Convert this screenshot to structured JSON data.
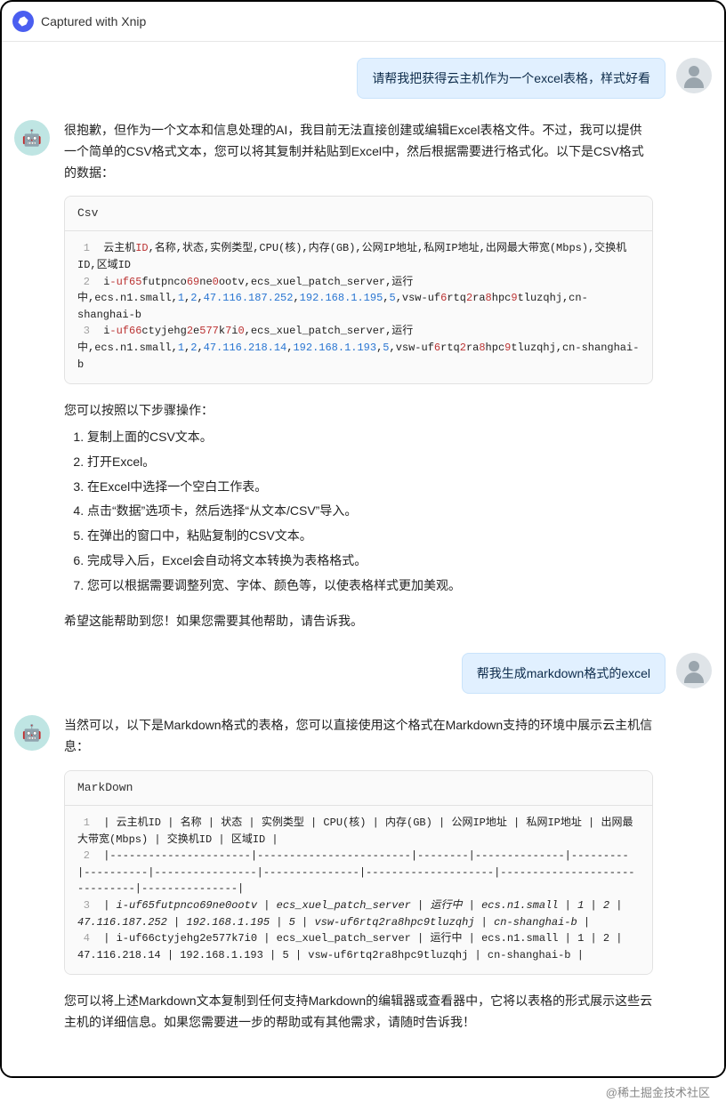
{
  "header": {
    "title": "Captured with Xnip"
  },
  "watermark": "@稀土掘金技术社区",
  "messages": {
    "user1": "请帮我把获得云主机作为一个excel表格，样式好看",
    "user2": "帮我生成markdown格式的excel",
    "asst1_intro": "很抱歉，但作为一个文本和信息处理的AI，我目前无法直接创建或编辑Excel表格文件。不过，我可以提供一个简单的CSV格式文本，您可以将其复制并粘贴到Excel中，然后根据需要进行格式化。以下是CSV格式的数据：",
    "asst1_steps_intro": "您可以按照以下步骤操作：",
    "asst1_steps": [
      "复制上面的CSV文本。",
      "打开Excel。",
      "在Excel中选择一个空白工作表。",
      "点击“数据”选项卡，然后选择“从文本/CSV”导入。",
      "在弹出的窗口中，粘贴复制的CSV文本。",
      "完成导入后，Excel会自动将文本转换为表格格式。",
      "您可以根据需要调整列宽、字体、颜色等，以使表格样式更加美观。"
    ],
    "asst1_outro": "希望这能帮助到您！如果您需要其他帮助，请告诉我。",
    "asst2_intro": "当然可以，以下是Markdown格式的表格，您可以直接使用这个格式在Markdown支持的环境中展示云主机信息：",
    "asst2_outro": "您可以将上述Markdown文本复制到任何支持Markdown的编辑器或查看器中，它将以表格的形式展示这些云主机的详细信息。如果您需要进一步的帮助或有其他需求，请随时告诉我！"
  },
  "codeblocks": {
    "csv": {
      "lang": "Csv",
      "lines": {
        "l1": {
          "num": "1",
          "parts": [
            {
              "t": " 云主机",
              "c": "cPlain"
            },
            {
              "t": "ID",
              "c": "cBool"
            },
            {
              "t": ",名称,状态,实例类型,CPU(核),内存(GB),公网IP地址,私网IP地址,出网最大带宽(Mbps),交换机ID,区域ID",
              "c": "cPlain"
            }
          ]
        },
        "l2": {
          "num": "2",
          "parts": [
            {
              "t": " i",
              "c": "cPlain"
            },
            {
              "t": "-uf65",
              "c": "cBool"
            },
            {
              "t": "futpnco",
              "c": "cPlain"
            },
            {
              "t": "69",
              "c": "cBool"
            },
            {
              "t": "ne",
              "c": "cPlain"
            },
            {
              "t": "0",
              "c": "cBool"
            },
            {
              "t": "ootv",
              "c": "cPlain"
            },
            {
              "t": ",ecs_xuel_patch_server,运行中,ecs.n1.small,",
              "c": "cPlain"
            },
            {
              "t": "1",
              "c": "cNum"
            },
            {
              "t": ",",
              "c": "cPlain"
            },
            {
              "t": "2",
              "c": "cNum"
            },
            {
              "t": ",",
              "c": "cPlain"
            },
            {
              "t": "47.116.187.252",
              "c": "cNum"
            },
            {
              "t": ",",
              "c": "cPlain"
            },
            {
              "t": "192.168.1.195",
              "c": "cNum"
            },
            {
              "t": ",",
              "c": "cPlain"
            },
            {
              "t": "5",
              "c": "cNum"
            },
            {
              "t": ",vsw-uf",
              "c": "cPlain"
            },
            {
              "t": "6",
              "c": "cBool"
            },
            {
              "t": "rtq",
              "c": "cPlain"
            },
            {
              "t": "2",
              "c": "cBool"
            },
            {
              "t": "ra",
              "c": "cPlain"
            },
            {
              "t": "8",
              "c": "cBool"
            },
            {
              "t": "hpc",
              "c": "cPlain"
            },
            {
              "t": "9",
              "c": "cBool"
            },
            {
              "t": "tluzqhj",
              "c": "cPlain"
            },
            {
              "t": ",cn-shanghai-b",
              "c": "cPlain"
            }
          ]
        },
        "l3": {
          "num": "3",
          "parts": [
            {
              "t": " i",
              "c": "cPlain"
            },
            {
              "t": "-uf66",
              "c": "cBool"
            },
            {
              "t": "ctyjehg",
              "c": "cPlain"
            },
            {
              "t": "2",
              "c": "cBool"
            },
            {
              "t": "e",
              "c": "cPlain"
            },
            {
              "t": "577",
              "c": "cBool"
            },
            {
              "t": "k",
              "c": "cPlain"
            },
            {
              "t": "7",
              "c": "cBool"
            },
            {
              "t": "i",
              "c": "cPlain"
            },
            {
              "t": "0",
              "c": "cBool"
            },
            {
              "t": ",ecs_xuel_patch_server,运行中,ecs.n1.small,",
              "c": "cPlain"
            },
            {
              "t": "1",
              "c": "cNum"
            },
            {
              "t": ",",
              "c": "cPlain"
            },
            {
              "t": "2",
              "c": "cNum"
            },
            {
              "t": ",",
              "c": "cPlain"
            },
            {
              "t": "47.116.218.14",
              "c": "cNum"
            },
            {
              "t": ",",
              "c": "cPlain"
            },
            {
              "t": "192.168.1.193",
              "c": "cNum"
            },
            {
              "t": ",",
              "c": "cPlain"
            },
            {
              "t": "5",
              "c": "cNum"
            },
            {
              "t": ",vsw-uf",
              "c": "cPlain"
            },
            {
              "t": "6",
              "c": "cBool"
            },
            {
              "t": "rtq",
              "c": "cPlain"
            },
            {
              "t": "2",
              "c": "cBool"
            },
            {
              "t": "ra",
              "c": "cPlain"
            },
            {
              "t": "8",
              "c": "cBool"
            },
            {
              "t": "hpc",
              "c": "cPlain"
            },
            {
              "t": "9",
              "c": "cBool"
            },
            {
              "t": "tluzqhj",
              "c": "cPlain"
            },
            {
              "t": ",cn-shanghai-b",
              "c": "cPlain"
            }
          ]
        }
      }
    },
    "md": {
      "lang": "MarkDown",
      "lines": {
        "l1": {
          "num": "1",
          "text": " | 云主机ID             | 名称                   | 状态   | 实例类型     | CPU(核) | 内存(GB) | 公网IP地址     | 私网IP地址    | 出网最大带宽(Mbps) | 交换机ID                     | 区域ID        |"
        },
        "l2": {
          "num": "2",
          "text": " |----------------------|------------------------|--------|--------------|---------|----------|----------------|---------------|--------------------|------------------------------|---------------|"
        },
        "l3": {
          "num": "3",
          "textItal": " | i-uf65futpnco69ne0ootv | ecs_xuel_patch_server | 运行中 | ecs.n1.small | 1       | 2        | 47.116.187.252 | 192.168.1.195 | 5                  | vsw-uf6rtq2ra8hpc9tluzqhj | cn-shanghai-b |"
        },
        "l4": {
          "num": "4",
          "text": " | i-uf66ctyjehg2e577k7i0 | ecs_xuel_patch_server | 运行中 | ecs.n1.small | 1       | 2        | 47.116.218.14  | 192.168.1.193 | 5                  | vsw-uf6rtq2ra8hpc9tluzqhj | cn-shanghai-b |"
        }
      }
    }
  }
}
